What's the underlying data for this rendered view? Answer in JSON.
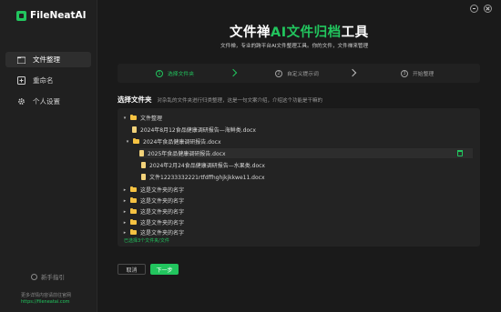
{
  "app": {
    "name": "FileNeatAI"
  },
  "sidebar": {
    "items": [
      {
        "label": "文件整理",
        "icon": "folder-icon",
        "active": true
      },
      {
        "label": "重命名",
        "icon": "rename-icon",
        "active": false
      },
      {
        "label": "个人设置",
        "icon": "gear-icon",
        "active": false
      }
    ],
    "guide_label": "新手指引",
    "footer_text": "更多详情内容请前往官网",
    "footer_url": "https://fileneatai.com"
  },
  "header": {
    "title_part1": "文件禅",
    "title_accent": "AI文件归档",
    "title_part2": "工具",
    "subtitle": "文件禅，专业的跨平台AI文件整理工具。你的文件，文件禅来管理"
  },
  "steps": [
    {
      "num": "1",
      "label": "选择文件夹",
      "active": true
    },
    {
      "num": "2",
      "label": "自定义提示词",
      "active": false
    },
    {
      "num": "3",
      "label": "开始整理",
      "active": false
    }
  ],
  "section": {
    "title": "选择文件夹",
    "description": "对杂乱的文件夹进行归类整理，这是一句文案介绍，介绍这个功能是干嘛的"
  },
  "tree": {
    "rows": [
      {
        "label": "文件整理",
        "kind": "folder",
        "caret": "▾"
      },
      {
        "label": "2024年8月12食品健康调研报告—海鲜类.docx",
        "kind": "file"
      },
      {
        "label": "2024年食品健康调研报告.docx",
        "kind": "folder",
        "caret": "▾"
      },
      {
        "label": "2025年食品健康调研报告.docx",
        "kind": "file"
      },
      {
        "label": "2024年2月24食品健康调研报告—水果类.docx",
        "kind": "file"
      },
      {
        "label": "文件12233332221rtfdffhghjkjkkwe11.docx",
        "kind": "file"
      },
      {
        "label": "这是文件夹的名字",
        "kind": "folder",
        "caret": "▸"
      },
      {
        "label": "这是文件夹的名字",
        "kind": "folder",
        "caret": "▸"
      },
      {
        "label": "这是文件夹的名字",
        "kind": "folder",
        "caret": "▸"
      },
      {
        "label": "这是文件夹的名字",
        "kind": "folder",
        "caret": "▸"
      },
      {
        "label": "这是文件夹的名字",
        "kind": "folder",
        "caret": "▸"
      }
    ],
    "status": "已选择3个文件夹/文件"
  },
  "buttons": {
    "cancel": "取消",
    "next": "下一步"
  }
}
